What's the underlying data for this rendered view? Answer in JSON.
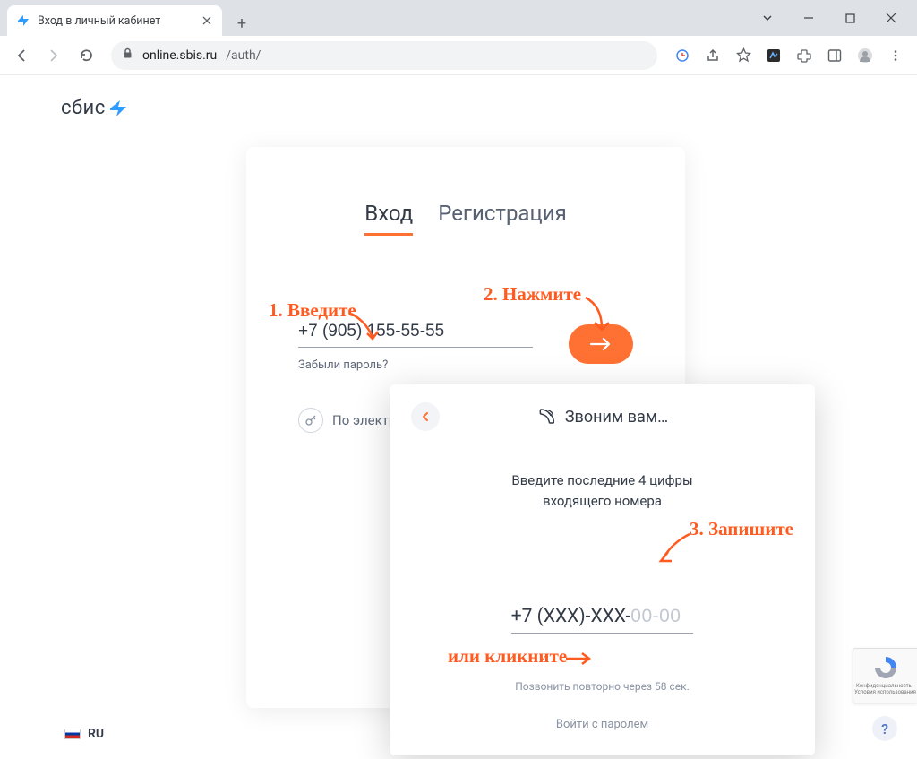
{
  "browser": {
    "tab_title": "Вход в личный кабинет",
    "url_host": "online.sbis.ru",
    "url_path": "/auth/"
  },
  "logo": {
    "text": "сбис"
  },
  "login_card": {
    "tabs": {
      "login": "Вход",
      "register": "Регистрация"
    },
    "phone_value": "+7 (905) 155-55-55",
    "forgot_password": "Забыли пароль?",
    "email_login_label": "По электр"
  },
  "call_popup": {
    "title": "Звоним вам…",
    "instruction_line1": "Введите последние 4 цифры",
    "instruction_line2": "входящего номера",
    "code_prefix": "+7 (ХХХ)-ХХХ-",
    "code_placeholder": "00-00",
    "retry_text": "Позвонить повторно через  58 сек.",
    "password_login": "Войти с паролем"
  },
  "annotations": {
    "step1": "1. Введите",
    "step2": "2. Нажмите",
    "step3": "3. Запишите",
    "or_click": "или кликните"
  },
  "lang": {
    "code": "RU"
  },
  "recaptcha": {
    "line1": "Конфиденциальность -",
    "line2": "Условия использования"
  }
}
